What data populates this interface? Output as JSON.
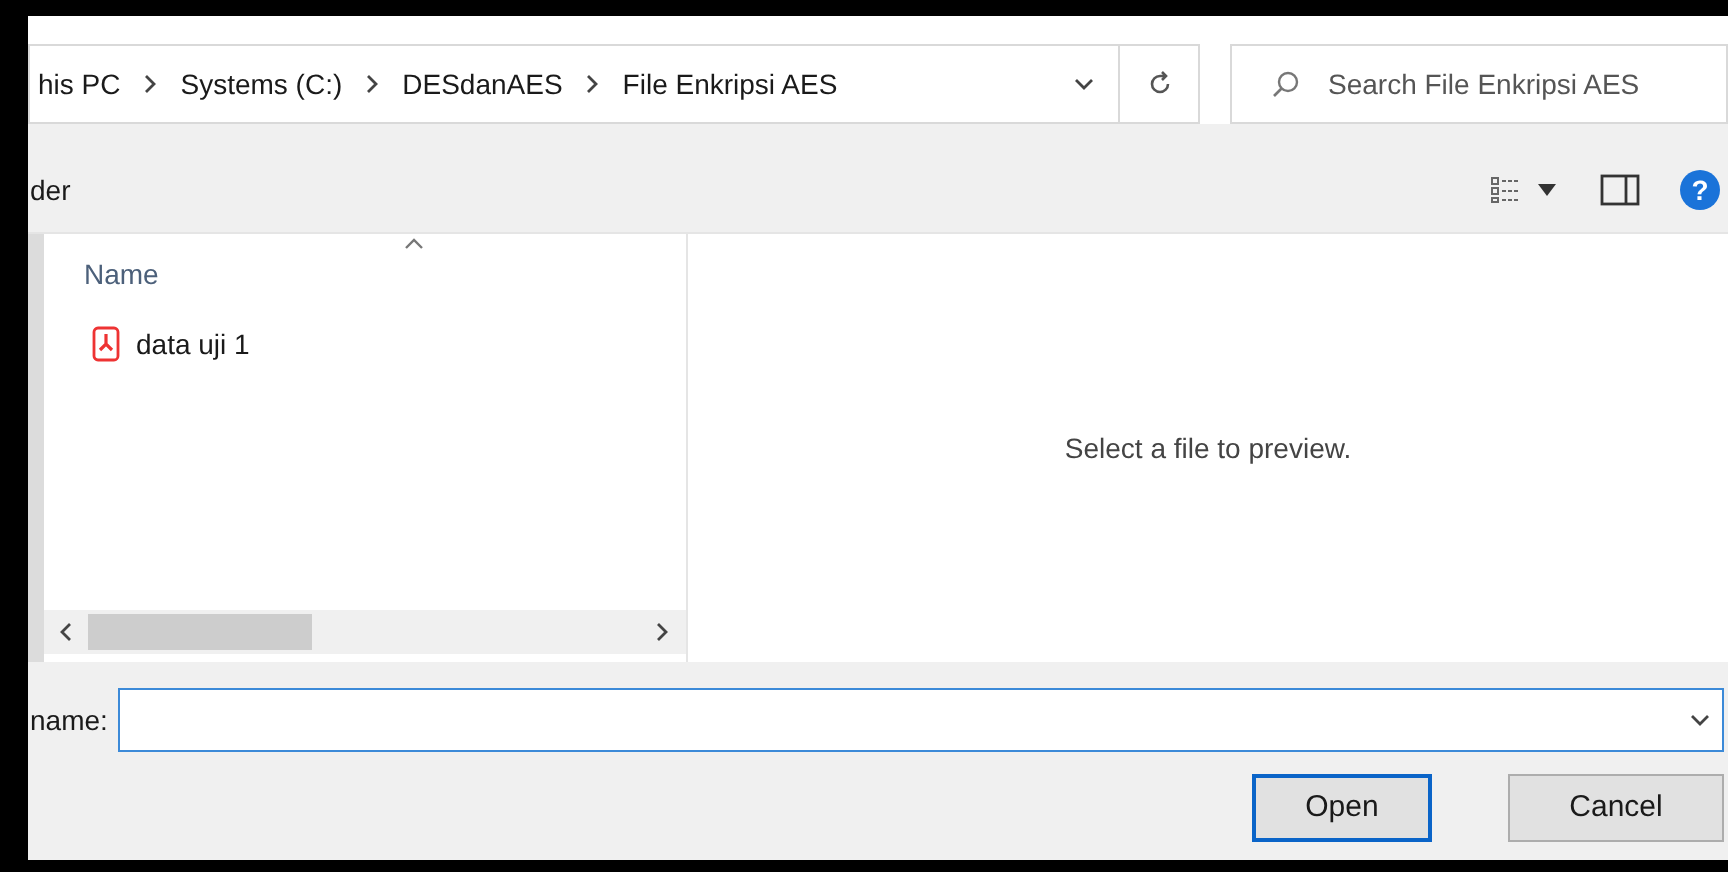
{
  "address_bar": {
    "crumbs": [
      "his PC",
      "Systems (C:)",
      "DESdanAES",
      "File Enkripsi AES"
    ]
  },
  "search": {
    "placeholder": "Search File Enkripsi AES"
  },
  "toolbar": {
    "label": "der",
    "help": "?"
  },
  "file_list": {
    "columns": [
      {
        "label": "Name",
        "sorted": true
      }
    ],
    "files": [
      {
        "name": "data uji 1",
        "kind": "pdf",
        "selected": false
      }
    ]
  },
  "preview": {
    "message": "Select a file to preview."
  },
  "file_name": {
    "label": "name:"
  },
  "buttons": [
    {
      "label": "Open",
      "default": true
    },
    {
      "label": "Cancel",
      "default": false
    }
  ]
}
